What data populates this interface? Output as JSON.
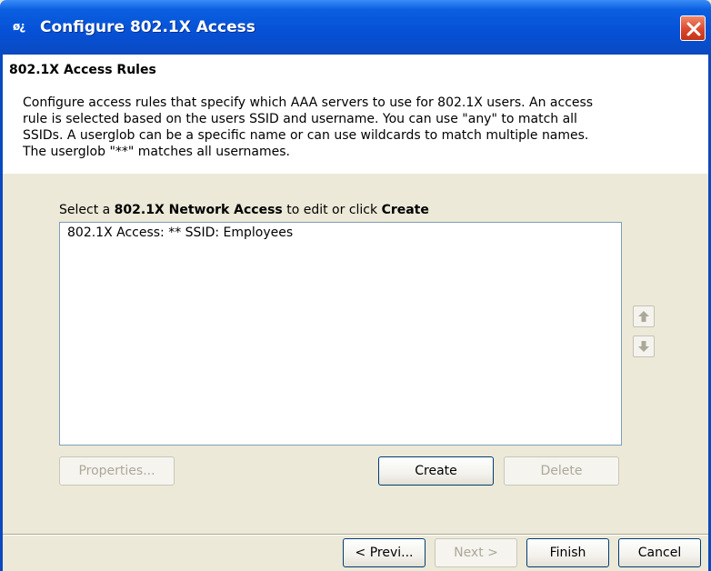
{
  "window": {
    "title": "Configure 802.1X Access",
    "icon_text": "ø¿"
  },
  "header": {
    "section_title": "802.1X Access Rules",
    "description": "Configure access rules that specify which AAA servers to use for 802.1X users. An access rule is selected based on the users SSID and username. You can use \"any\" to match all SSIDs. A userglob can be a specific name or can use wildcards to match multiple names. The userglob \"**\" matches all usernames."
  },
  "list": {
    "caption_prefix": "Select a ",
    "caption_bold_1": "802.1X Network Access",
    "caption_mid": " to edit or click ",
    "caption_bold_2": "Create",
    "items": [
      "802.1X Access: ** SSID: Employees"
    ]
  },
  "buttons": {
    "properties": "Properties...",
    "create": "Create",
    "delete": "Delete",
    "previous": "< Previ...",
    "next": "Next >",
    "finish": "Finish",
    "cancel": "Cancel"
  },
  "icons": {
    "move_up": "arrow-up-icon",
    "move_down": "arrow-down-icon",
    "close": "close-icon"
  },
  "colors": {
    "titlebar": "#0650d6",
    "close_button": "#d9442a",
    "dialog_background": "#ECE9D8",
    "disabled_text": "#aca899"
  }
}
